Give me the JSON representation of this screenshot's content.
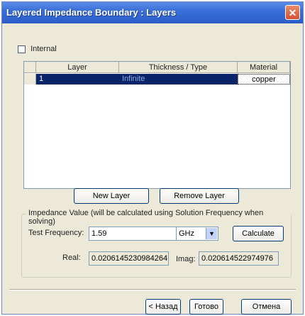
{
  "window": {
    "title": "Layered Impedance Boundary : Layers",
    "close_glyph": "✕"
  },
  "internal_checkbox": {
    "label": "Internal",
    "checked": false
  },
  "table": {
    "columns": [
      "Layer",
      "Thickness / Type",
      "Material"
    ],
    "rows": [
      {
        "layer": "1",
        "thickness": "Infinite",
        "material": "copper"
      }
    ]
  },
  "buttons": {
    "new_layer": "New Layer",
    "remove_layer": "Remove Layer",
    "calculate": "Calculate",
    "back": "< Назад",
    "finish": "Готово",
    "cancel": "Отмена"
  },
  "impedance": {
    "legend": "Impedance Value (will be calculated using Solution Frequency when solving)",
    "test_frequency_label": "Test Frequency:",
    "test_frequency_value": "1.59",
    "unit_selected": "GHz",
    "real_label": "Real:",
    "real_value": "0.0206145230984264",
    "imag_label": "Imag:",
    "imag_value": "0.020614522974976"
  },
  "colors": {
    "title_bar": "#2b5cc8",
    "selection": "#0a246a",
    "dialog_bg": "#ece9d8"
  }
}
